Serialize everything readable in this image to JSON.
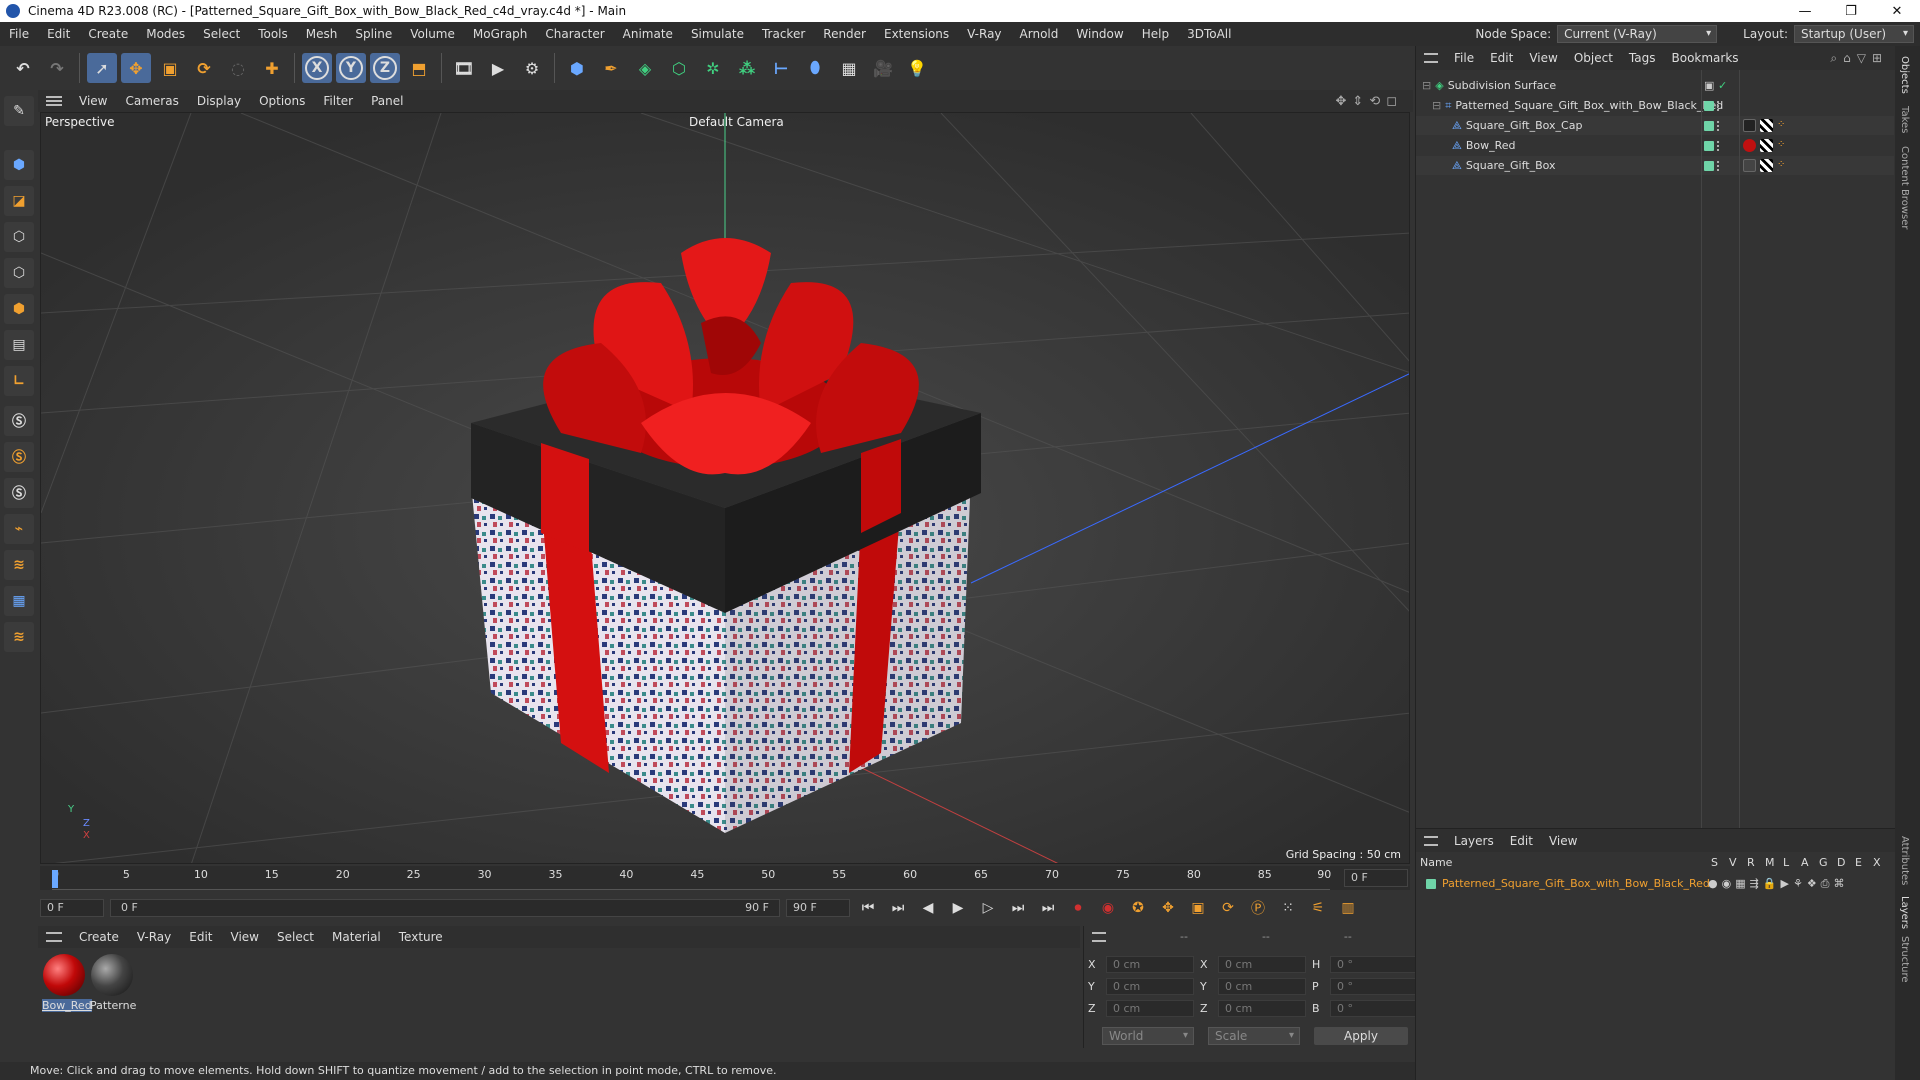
{
  "window": {
    "title": "Cinema 4D R23.008 (RC) - [Patterned_Square_Gift_Box_with_Bow_Black_Red_c4d_vray.c4d *] - Main",
    "minimize": "—",
    "maximize": "❐",
    "close": "✕"
  },
  "menubar": {
    "items": [
      "File",
      "Edit",
      "Create",
      "Modes",
      "Select",
      "Tools",
      "Mesh",
      "Spline",
      "Volume",
      "MoGraph",
      "Character",
      "Animate",
      "Simulate",
      "Tracker",
      "Render",
      "Extensions",
      "V-Ray",
      "Arnold",
      "Window",
      "Help",
      "3DToAll"
    ],
    "node_space_label": "Node Space:",
    "node_space_value": "Current (V-Ray)",
    "layout_label": "Layout:",
    "layout_value": "Startup (User)"
  },
  "toolbar": {
    "axis_x": "X",
    "axis_y": "Y",
    "axis_z": "Z"
  },
  "viewport": {
    "menu": [
      "View",
      "Cameras",
      "Display",
      "Options",
      "Filter",
      "Panel"
    ],
    "view_name": "Perspective",
    "camera_name": "Default Camera",
    "grid_spacing": "Grid Spacing : 50 cm",
    "axis_y": "Y",
    "axis_z": "Z",
    "axis_x": "X"
  },
  "timeline": {
    "ticks": [
      "0",
      "5",
      "10",
      "15",
      "20",
      "25",
      "30",
      "35",
      "40",
      "45",
      "50",
      "55",
      "60",
      "65",
      "70",
      "75",
      "80",
      "85",
      "90"
    ],
    "current_frame_right": "0 F",
    "start_field": "0 F",
    "range_start": "0 F",
    "range_end": "90 F",
    "end_field": "90 F"
  },
  "materials": {
    "menu": [
      "Create",
      "V-Ray",
      "Edit",
      "View",
      "Select",
      "Material",
      "Texture"
    ],
    "items": [
      {
        "label": "Bow_Red"
      },
      {
        "label": "Patterne"
      }
    ]
  },
  "coordinates": {
    "header": [
      "--",
      "--",
      "--"
    ],
    "rows": [
      {
        "a": "X",
        "av": "0 cm",
        "b": "X",
        "bv": "0 cm",
        "c": "H",
        "cv": "0 °"
      },
      {
        "a": "Y",
        "av": "0 cm",
        "b": "Y",
        "bv": "0 cm",
        "c": "P",
        "cv": "0 °"
      },
      {
        "a": "Z",
        "av": "0 cm",
        "b": "Z",
        "bv": "0 cm",
        "c": "B",
        "cv": "0 °"
      }
    ],
    "mode_world": "World",
    "mode_scale": "Scale",
    "apply": "Apply"
  },
  "status": "Move: Click and drag to move elements. Hold down SHIFT to quantize movement / add to the selection in point mode, CTRL to remove.",
  "objects": {
    "menu": [
      "File",
      "Edit",
      "View",
      "Object",
      "Tags",
      "Bookmarks"
    ],
    "tree": [
      {
        "name": "Subdivision Surface"
      },
      {
        "name": "Patterned_Square_Gift_Box_with_Bow_Black_Red"
      },
      {
        "name": "Square_Gift_Box_Cap"
      },
      {
        "name": "Bow_Red"
      },
      {
        "name": "Square_Gift_Box"
      }
    ]
  },
  "layers": {
    "menu": [
      "Layers",
      "Edit",
      "View"
    ],
    "name_header": "Name",
    "flags": [
      "S",
      "V",
      "R",
      "M",
      "L",
      "A",
      "G",
      "D",
      "E",
      "X"
    ],
    "items": [
      {
        "name": "Patterned_Square_Gift_Box_with_Bow_Black_Red"
      }
    ]
  },
  "side_tabs": [
    "Objects",
    "Takes",
    "Content Browser",
    "Attributes",
    "Layers",
    "Structure"
  ],
  "colors": {
    "accent_blue": "#4a6a9a",
    "layer_orange": "#f0a030",
    "object_green": "#6fd4a8",
    "bow_red": "#d01010"
  }
}
